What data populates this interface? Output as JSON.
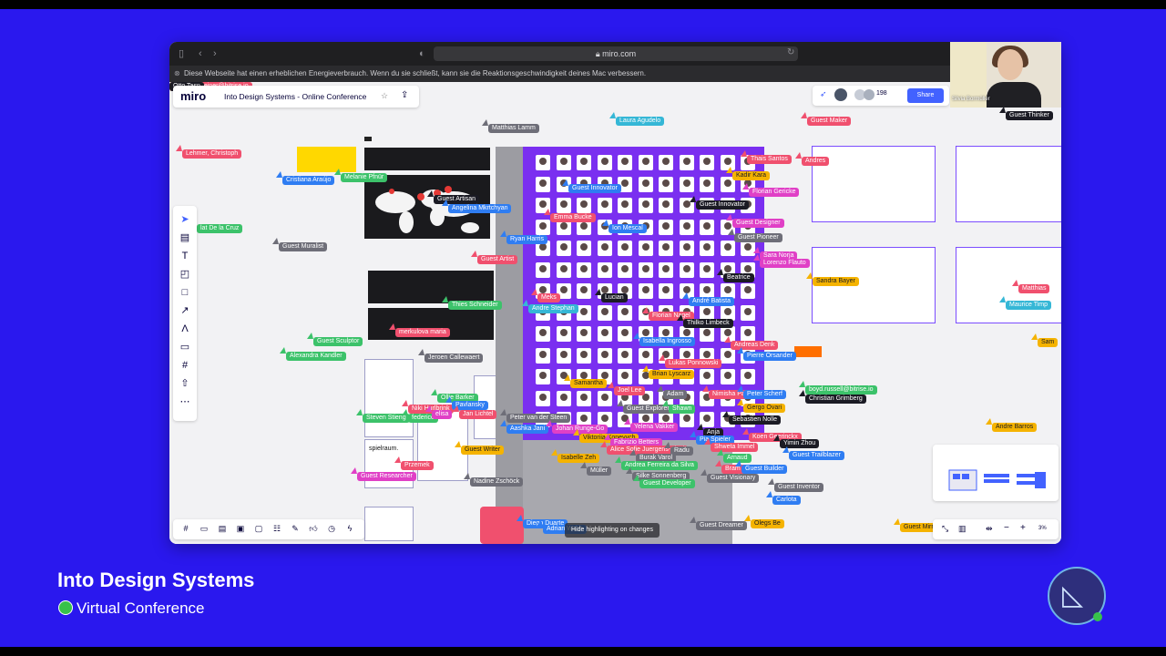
{
  "browser": {
    "url": "miro.com",
    "energy_notice": "Diese Webseite hat einen erheblichen Energieverbrauch. Wenn du sie schließt, kann sie die Reaktionsgeschwindigkeit deines Mac verbessern."
  },
  "miro": {
    "logo": "miro",
    "board_name": "Into Design Systems - Online Conference",
    "share_label": "Share",
    "participant_count": "198",
    "zoom": "3%",
    "hide_highlighting": "Hide highlighting on changes",
    "frame_text": {
      "spielraum": "spielraum."
    }
  },
  "webcam": {
    "name": "Silvia Bormüller"
  },
  "cursors": [
    {
      "label": "Matthias Lamm",
      "color": "#6e6e78"
    },
    {
      "label": "Laura Agudelo",
      "color": "#35b7d6"
    },
    {
      "label": "Guest Maker",
      "color": "#f0506e"
    },
    {
      "label": "Guest Thinker",
      "color": "#1b1b24"
    },
    {
      "label": "Lehmer, Christoph",
      "color": "#f0506e"
    },
    {
      "label": "Cristiana Araújo",
      "color": "#2f7df2"
    },
    {
      "label": "Melanie Pfnür",
      "color": "#3cc26a"
    },
    {
      "label": "Thais Santos",
      "color": "#f0506e"
    },
    {
      "label": "Andres",
      "color": "#f0506e"
    },
    {
      "label": "Kadir Kara",
      "color": "#f5b300"
    },
    {
      "label": "Florian Gericke",
      "color": "#e040c6"
    },
    {
      "label": "Guest Innovator",
      "color": "#2f7df2"
    },
    {
      "label": "Guest Artisan",
      "color": "#1b1b24"
    },
    {
      "label": "Angelina Mkrtchyan",
      "color": "#2f7df2"
    },
    {
      "label": "Guest Innovator",
      "color": "#1b1b24"
    },
    {
      "label": "Emma Bucke",
      "color": "#f0506e"
    },
    {
      "label": "Ion Mescal",
      "color": "#2f7df2"
    },
    {
      "label": "Guest Designer",
      "color": "#e040c6"
    },
    {
      "label": "lat De la Cruz",
      "color": "#3cc26a"
    },
    {
      "label": "Guest Muralist",
      "color": "#6e6e78"
    },
    {
      "label": "Ryan Harris",
      "color": "#2f7df2"
    },
    {
      "label": "Guest Pioneer",
      "color": "#6e6e78"
    },
    {
      "label": "Guest Artist",
      "color": "#f0506e"
    },
    {
      "label": "Sara Norja",
      "color": "#e040c6"
    },
    {
      "label": "Lorenzo Flauto",
      "color": "#e040c6"
    },
    {
      "label": "Sandra Bayer",
      "color": "#f5b300"
    },
    {
      "label": "Beatrice",
      "color": "#1b1b24"
    },
    {
      "label": "Thies Schneider",
      "color": "#3cc26a"
    },
    {
      "label": "Meks",
      "color": "#f0506e"
    },
    {
      "label": "Lucian",
      "color": "#1b1b24"
    },
    {
      "label": "André Batista",
      "color": "#2f7df2"
    },
    {
      "label": "Matthias",
      "color": "#f0506e"
    },
    {
      "label": "Maurice Timp",
      "color": "#35b7d6"
    },
    {
      "label": "Andre Stephan",
      "color": "#35b7d6"
    },
    {
      "label": "Florian Nagel",
      "color": "#f0506e"
    },
    {
      "label": "Thilko Limbeck",
      "color": "#1b1b24"
    },
    {
      "label": "merkulova maria",
      "color": "#f0506e"
    },
    {
      "label": "Guest Sculptor",
      "color": "#3cc26a"
    },
    {
      "label": "Isabella Ingrosso",
      "color": "#2f7df2"
    },
    {
      "label": "Andreas Denk",
      "color": "#f0506e"
    },
    {
      "label": "Sam",
      "color": "#f5b300"
    },
    {
      "label": "Alexandra Kandler",
      "color": "#3cc26a"
    },
    {
      "label": "Jeroen Callewaert",
      "color": "#6e6e78"
    },
    {
      "label": "Lukas Ponnowski",
      "color": "#f0506e"
    },
    {
      "label": "Pierre Orsander",
      "color": "#2f7df2"
    },
    {
      "label": "Brian Lyscarz",
      "color": "#f5b300"
    },
    {
      "label": "Samantha",
      "color": "#f5b300"
    },
    {
      "label": "Joel Lee",
      "color": "#f0506e"
    },
    {
      "label": "Adam",
      "color": "#6e6e78"
    },
    {
      "label": "Nimisha Patil",
      "color": "#f0506e"
    },
    {
      "label": "Peter Scherf",
      "color": "#2f7df2"
    },
    {
      "label": "boyd.russell@bitrise.io",
      "color": "#3cc26a"
    },
    {
      "label": "Christian Grimberg",
      "color": "#1b1b24"
    },
    {
      "label": "Ollie Barker",
      "color": "#3cc26a"
    },
    {
      "label": "Niki Hurlbrink",
      "color": "#f0506e"
    },
    {
      "label": "Pavlansky",
      "color": "#2f7df2"
    },
    {
      "label": "Guest Explorer",
      "color": "#6e6e78"
    },
    {
      "label": "Shawn",
      "color": "#3cc26a"
    },
    {
      "label": "Gergo Ovari",
      "color": "#f5b300"
    },
    {
      "label": "Steven Stieng",
      "color": "#3cc26a"
    },
    {
      "label": "federico",
      "color": "#3cc26a"
    },
    {
      "label": "elisa",
      "color": "#e040c6"
    },
    {
      "label": "Jan Lichtel",
      "color": "#f0506e"
    },
    {
      "label": "Peter van der Steen",
      "color": "#6e6e78"
    },
    {
      "label": "Sebastien Nolle",
      "color": "#1b1b24"
    },
    {
      "label": "Aashka Jani",
      "color": "#2f7df2"
    },
    {
      "label": "Johan Runge-Go",
      "color": "#e040c6"
    },
    {
      "label": "Yelena Vakker",
      "color": "#e040c6"
    },
    {
      "label": "Anja",
      "color": "#1b1b24"
    },
    {
      "label": "Koen Geerinckx",
      "color": "#f0506e"
    },
    {
      "label": "Andre Barros",
      "color": "#f5b300"
    },
    {
      "label": "Viktoriia Konevych",
      "color": "#f5b300"
    },
    {
      "label": "Fabrizio Betters",
      "color": "#e040c6"
    },
    {
      "label": "Pia Spieler",
      "color": "#2f7df2"
    },
    {
      "label": "Yimin Zhou",
      "color": "#1b1b24"
    },
    {
      "label": "Guest Writer",
      "color": "#f5b300"
    },
    {
      "label": "Alice Sofie Juergens-Ajayi",
      "color": "#f0506e"
    },
    {
      "label": "Shweta Immel",
      "color": "#f0506e"
    },
    {
      "label": "Radu",
      "color": "#6e6e78"
    },
    {
      "label": "Burak Varol",
      "color": "#6e6e78"
    },
    {
      "label": "Arnaud",
      "color": "#3cc26a"
    },
    {
      "label": "Guest Trailblazer",
      "color": "#2f7df2"
    },
    {
      "label": "Isabelle Zeh",
      "color": "#f5b300"
    },
    {
      "label": "Andrea Ferreira da Silva",
      "color": "#3cc26a"
    },
    {
      "label": "Bram Ruiten",
      "color": "#f0506e"
    },
    {
      "label": "Guest Builder",
      "color": "#2f7df2"
    },
    {
      "label": "Przemek",
      "color": "#f0506e"
    },
    {
      "label": "Müller",
      "color": "#6e6e78"
    },
    {
      "label": "Silke Sonnenberg",
      "color": "#6e6e78"
    },
    {
      "label": "Guest Visionary",
      "color": "#6e6e78"
    },
    {
      "label": "Guest Researcher",
      "color": "#e040c6"
    },
    {
      "label": "Nadine Zschöck",
      "color": "#6e6e78"
    },
    {
      "label": "Guest Developer",
      "color": "#3cc26a"
    },
    {
      "label": "Guest Inventor",
      "color": "#6e6e78"
    },
    {
      "label": "Carlota",
      "color": "#2f7df2"
    },
    {
      "label": "Diego Duarte",
      "color": "#2f7df2"
    },
    {
      "label": "Adrian Wach",
      "color": "#2f7df2"
    },
    {
      "label": "Guest Dreamer",
      "color": "#6e6e78"
    },
    {
      "label": "Olegs Be",
      "color": "#f5b300"
    },
    {
      "label": "Guest Mirrorer",
      "color": "#f5b300"
    },
    {
      "label": "csaba.schreiner@bitrise.io",
      "color": "#f0506e"
    },
    {
      "label": "Otto Tasn",
      "color": "#1b1b24"
    }
  ],
  "footer": {
    "title": "Into Design Systems",
    "subtitle": "Virtual Conference"
  }
}
